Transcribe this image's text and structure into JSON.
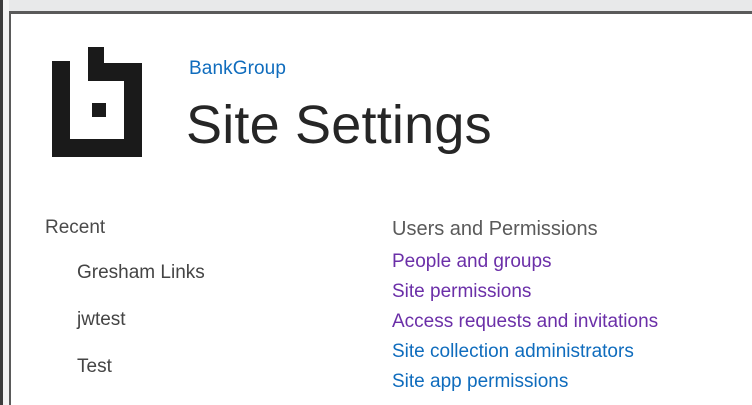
{
  "header": {
    "site_name": "BankGroup",
    "page_title": "Site Settings",
    "logo_icon": "bookmark-b-logo-icon"
  },
  "recent": {
    "heading": "Recent",
    "items": [
      {
        "label": "Gresham Links"
      },
      {
        "label": "jwtest"
      },
      {
        "label": "Test"
      }
    ]
  },
  "users_and_permissions": {
    "heading": "Users and Permissions",
    "links": [
      {
        "label": "People and groups",
        "state": "visited"
      },
      {
        "label": "Site permissions",
        "state": "visited"
      },
      {
        "label": "Access requests and invitations",
        "state": "visited"
      },
      {
        "label": "Site collection administrators",
        "state": "link"
      },
      {
        "label": "Site app permissions",
        "state": "link"
      }
    ]
  },
  "colors": {
    "link": "#0f6cbd",
    "visited_link": "#6b2fa8",
    "text": "#444444",
    "title": "#262626"
  }
}
